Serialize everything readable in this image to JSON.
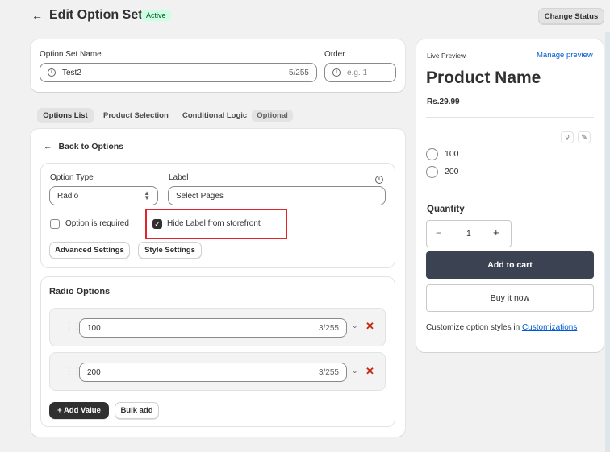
{
  "header": {
    "back_icon": "arrow-left-icon",
    "title": "Edit Option Set",
    "status_badge": "Active",
    "change_status_label": "Change Status"
  },
  "form": {
    "name_label": "Option Set Name",
    "name_value": "Test2",
    "name_counter": "5/255",
    "order_label": "Order",
    "order_placeholder": "e.g. 1"
  },
  "tabs": {
    "options_list": "Options List",
    "product_selection": "Product Selection",
    "conditional_logic": "Conditional Logic",
    "optional_badge": "Optional"
  },
  "editor": {
    "back_label": "Back to Options",
    "option_type_label": "Option Type",
    "option_type_value": "Radio",
    "label_label": "Label",
    "label_value": "Select Pages",
    "required_label": "Option is required",
    "hide_label_label": "Hide Label from storefront",
    "advanced_settings": "Advanced Settings",
    "style_settings": "Style Settings",
    "radio_options_title": "Radio Options",
    "values": [
      {
        "value": "100",
        "counter": "3/255"
      },
      {
        "value": "200",
        "counter": "3/255"
      }
    ],
    "add_value": "+ Add Value",
    "bulk_add": "Bulk add"
  },
  "preview": {
    "title": "Live Preview",
    "manage_link": "Manage preview",
    "product_name": "Product Name",
    "price": "Rs.29.99",
    "options": [
      "100",
      "200"
    ],
    "quantity_label": "Quantity",
    "quantity_value": "1",
    "minus": "−",
    "plus": "+",
    "add_to_cart": "Add to cart",
    "buy_now": "Buy it now",
    "customize_text": "Customize option styles in",
    "customize_link": "Customizations"
  },
  "colors": {
    "badge_bg": "#cdfee1",
    "badge_text": "#0c5132",
    "primary_button": "#3b4252",
    "link": "#005bd3",
    "delete": "#c5280c",
    "highlight": "#e0262b"
  }
}
